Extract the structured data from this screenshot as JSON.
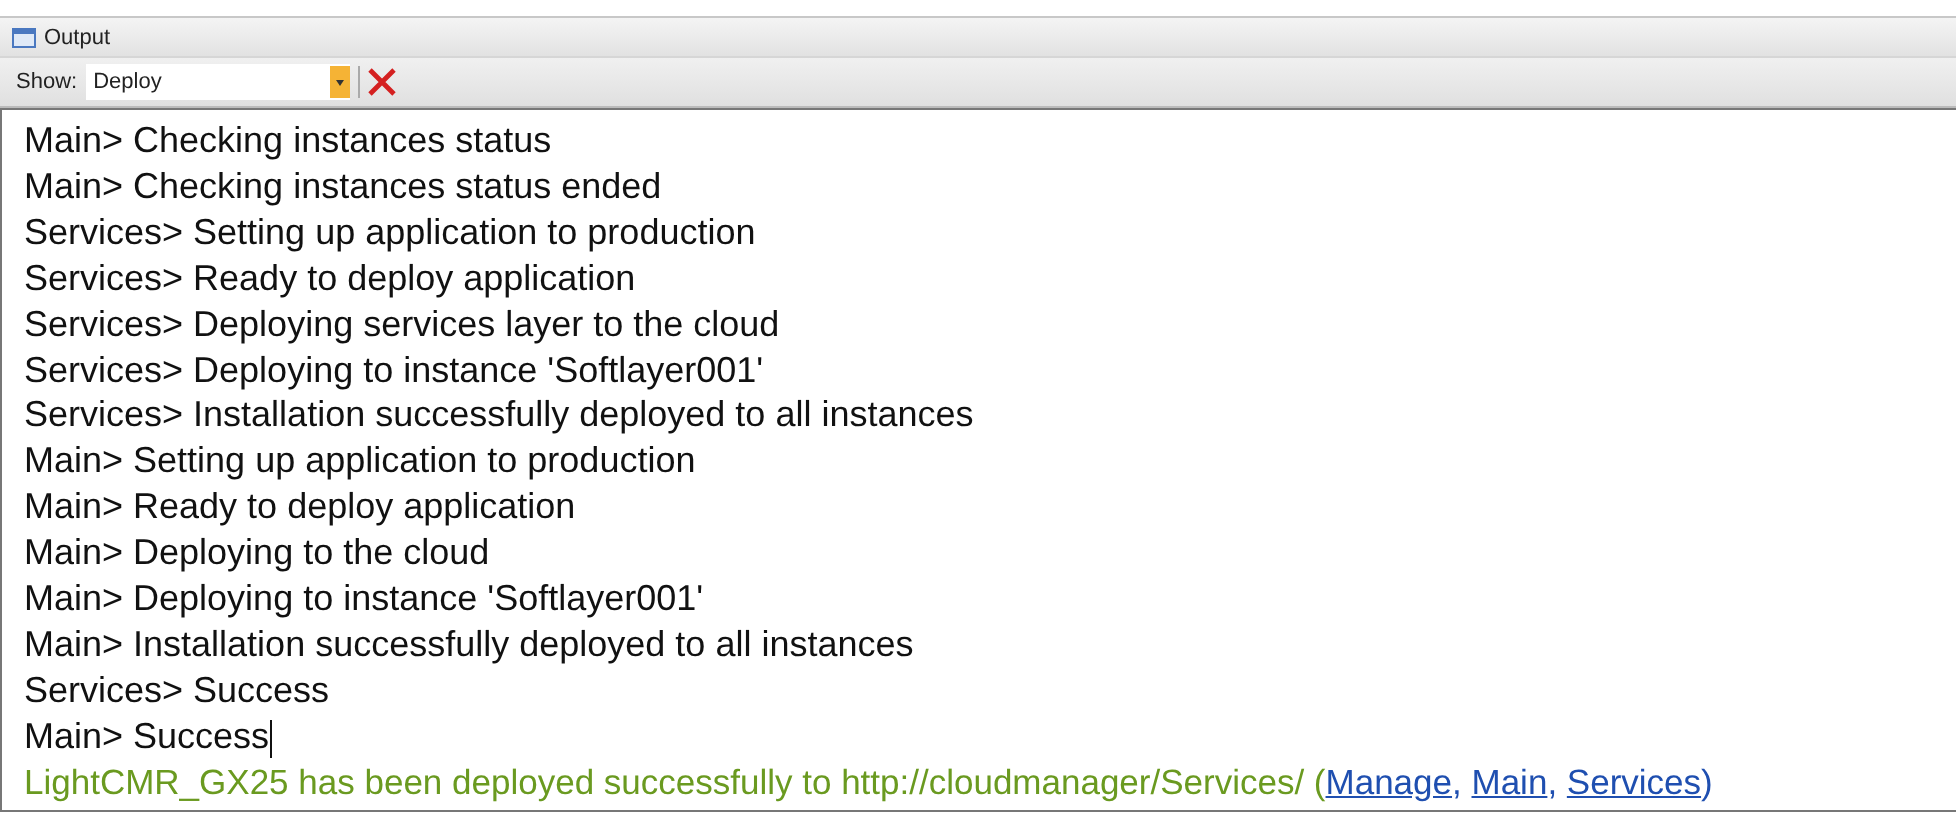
{
  "panel": {
    "title": "Output"
  },
  "toolbar": {
    "show_label": "Show:",
    "dropdown_value": "Deploy"
  },
  "lines": [
    {
      "kind": "log",
      "text": "Main> Checking instances status"
    },
    {
      "kind": "log",
      "text": "Main> Checking instances status ended"
    },
    {
      "kind": "log",
      "text": "Services> Setting up application to production"
    },
    {
      "kind": "log",
      "text": "Services> Ready to deploy application"
    },
    {
      "kind": "log",
      "text": "Services> Deploying services layer to the cloud"
    },
    {
      "kind": "log",
      "text": "Services> Deploying to instance 'Softlayer001'"
    },
    {
      "kind": "log",
      "text": "Services> Installation successfully deployed to all instances"
    },
    {
      "kind": "log",
      "text": "Main> Setting up application to production"
    },
    {
      "kind": "log",
      "text": "Main> Ready to deploy application"
    },
    {
      "kind": "log",
      "text": "Main> Deploying to the cloud"
    },
    {
      "kind": "log",
      "text": "Main> Deploying to instance 'Softlayer001'"
    },
    {
      "kind": "log",
      "text": "Main> Installation successfully deployed to all instances"
    },
    {
      "kind": "log",
      "text": "Services> Success"
    },
    {
      "kind": "log",
      "text": "Main> Success",
      "cursor": true
    },
    {
      "kind": "result",
      "text": "LightCMR_GX25 has been deployed successfully to http://cloudmanager/Services/ (",
      "links": [
        "Manage",
        "Main",
        "Services"
      ],
      "separator": ", ",
      "close": ")"
    }
  ]
}
